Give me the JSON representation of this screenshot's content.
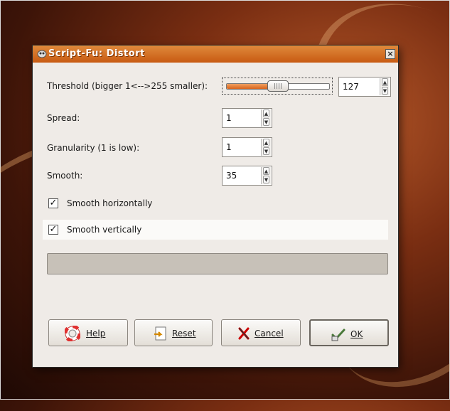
{
  "dialog": {
    "title": "Script-Fu: Distort",
    "close_label": "×"
  },
  "threshold": {
    "label": "Threshold (bigger 1<-->255 smaller):",
    "value": "127",
    "slider_fraction": 0.5
  },
  "spread": {
    "label": "Spread:",
    "value": "1"
  },
  "granularity": {
    "label": "Granularity (1 is low):",
    "value": "1"
  },
  "smooth": {
    "label": "Smooth:",
    "value": "35"
  },
  "smooth_h": {
    "label": "Smooth horizontally",
    "checked": "✓"
  },
  "smooth_v": {
    "label": "Smooth vertically",
    "checked": "✓"
  },
  "spin_arrows": {
    "up": "▲",
    "down": "▼"
  },
  "buttons": {
    "help": "Help",
    "reset": "Reset",
    "cancel": "Cancel",
    "ok": "OK"
  },
  "colors": {
    "accent": "#d8641c",
    "titlebar": "#c85a12"
  }
}
